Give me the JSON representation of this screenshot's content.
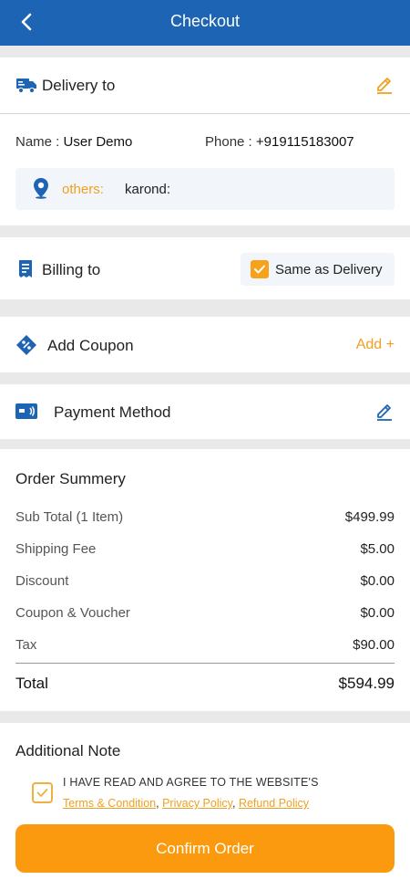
{
  "header": {
    "title": "Checkout"
  },
  "delivery": {
    "title": "Delivery to",
    "name_label": "Name : ",
    "name_value": "User Demo",
    "phone_label": "Phone : ",
    "phone_value": "+919115183007",
    "address_label": "others:",
    "address_value": "karond:"
  },
  "billing": {
    "title": "Billing to",
    "same_as_label": "Same as Delivery",
    "same_as_checked": true
  },
  "coupon": {
    "title": "Add Coupon",
    "add_label": "Add +"
  },
  "payment": {
    "title": "Payment Method"
  },
  "summary": {
    "title": "Order Summery",
    "rows": [
      {
        "label": "Sub Total (1 Item)",
        "value": "$499.99"
      },
      {
        "label": "Shipping Fee",
        "value": "$5.00"
      },
      {
        "label": "Discount",
        "value": "$0.00"
      },
      {
        "label": "Coupon & Voucher",
        "value": "$0.00"
      },
      {
        "label": "Tax",
        "value": "$90.00"
      }
    ],
    "total_label": "Total",
    "total_value": "$594.99"
  },
  "note": {
    "title": "Additional Note",
    "agree_text": "I HAVE READ AND AGREE TO THE WEBSITE'S",
    "links": [
      "Terms & Condition",
      "Privacy Policy",
      "Refund Policy"
    ],
    "separator": ","
  },
  "confirm_label": "Confirm Order",
  "colors": {
    "primary": "#1e64b4",
    "accent": "#fb9a0e",
    "link": "#f0a020"
  }
}
